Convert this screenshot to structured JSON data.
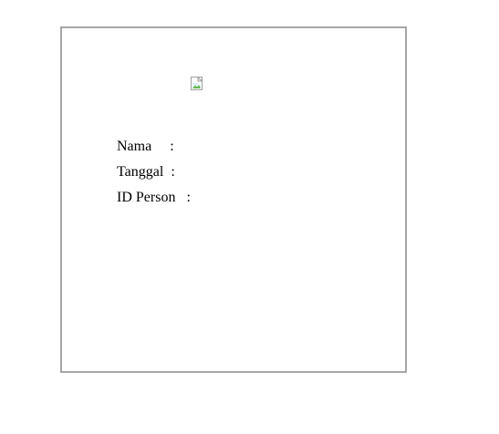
{
  "card": {
    "image_icon": "broken-image-icon",
    "fields": {
      "nama": {
        "label": "Nama",
        "separator": ":"
      },
      "tanggal": {
        "label": "Tanggal",
        "separator": ":"
      },
      "id_person": {
        "label": "ID Person",
        "separator": ":"
      }
    }
  },
  "colors": {
    "border": "#a6a6a6",
    "background": "#ffffff",
    "text": "#000000"
  }
}
